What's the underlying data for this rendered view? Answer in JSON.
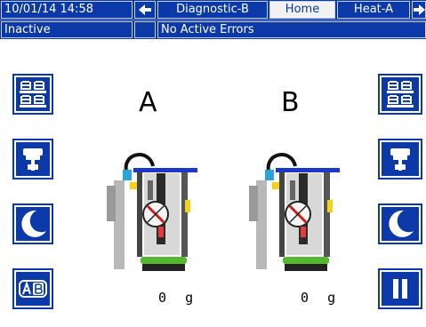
{
  "header": {
    "datetime": "10/01/14 14:58",
    "back_arrow_icon": "left-arrow-icon",
    "tabs": [
      {
        "label": "Diagnostic-B",
        "active": false
      },
      {
        "label": "Home",
        "active": true
      },
      {
        "label": "Heat-A",
        "active": false
      }
    ],
    "forward_arrow_icon": "right-arrow-icon"
  },
  "status": {
    "state": "Inactive",
    "errors": "No Active Errors"
  },
  "pumps": [
    {
      "label": "A",
      "weight_value": "0",
      "weight_unit": "g"
    },
    {
      "label": "B",
      "weight_value": "0",
      "weight_unit": "g"
    }
  ],
  "left_buttons": [
    "drums-icon",
    "ram-icon",
    "sleep-moon-icon",
    "ab-icon"
  ],
  "right_buttons": [
    "drums-icon",
    "ram-icon",
    "sleep-moon-icon",
    "pause-icon"
  ],
  "colors": {
    "bar": "#0b3aa8",
    "button": "#0b3aa8",
    "accent_green": "#55b82f",
    "accent_yellow": "#f2d21b",
    "hose_blue": "#1b38c8"
  }
}
